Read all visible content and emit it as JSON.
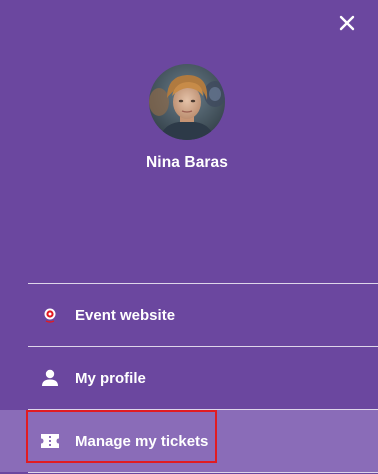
{
  "header": {
    "close_icon": "close-icon"
  },
  "profile": {
    "name": "Nina Baras",
    "avatar": "avatar-photo"
  },
  "menu": {
    "items": [
      {
        "label": "Event website",
        "icon": "event-logo-icon"
      },
      {
        "label": "My profile",
        "icon": "user-icon"
      },
      {
        "label": "Manage my tickets",
        "icon": "ticket-icon",
        "active": true
      }
    ]
  },
  "colors": {
    "background": "#6b479f",
    "active_background": "#8a6cb8",
    "highlight_border": "#e11b22",
    "text": "#ffffff"
  }
}
